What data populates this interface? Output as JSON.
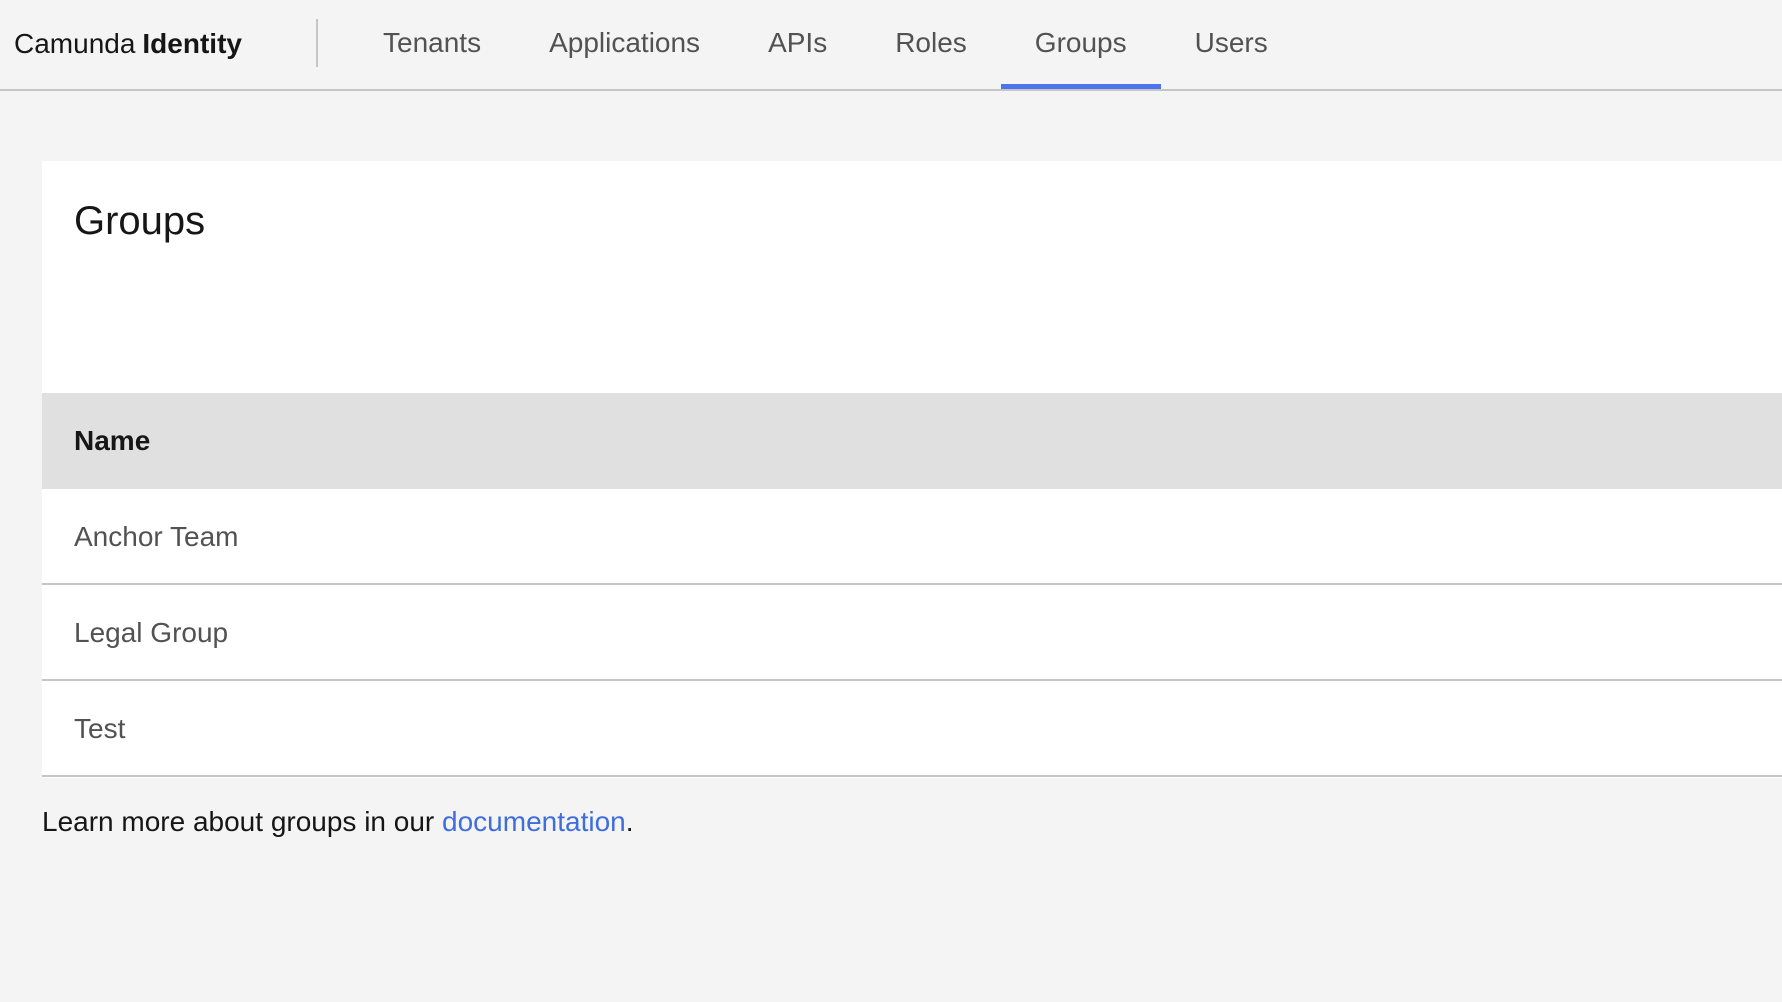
{
  "header": {
    "brand_prefix": "Camunda",
    "brand_strong": "Identity",
    "tabs": [
      {
        "label": "Tenants",
        "active": false
      },
      {
        "label": "Applications",
        "active": false
      },
      {
        "label": "APIs",
        "active": false
      },
      {
        "label": "Roles",
        "active": false
      },
      {
        "label": "Groups",
        "active": true
      },
      {
        "label": "Users",
        "active": false
      }
    ]
  },
  "main": {
    "title": "Groups",
    "table": {
      "columns": [
        "Name"
      ],
      "rows": [
        {
          "name": "Anchor Team"
        },
        {
          "name": "Legal Group"
        },
        {
          "name": "Test"
        }
      ]
    },
    "footer": {
      "text_before": "Learn more about groups in our ",
      "link_text": "documentation",
      "text_after": "."
    }
  },
  "colors": {
    "accent": "#4d74ec",
    "link": "#3f6ddd",
    "background": "#f4f4f4",
    "table_header": "#e0e0e0"
  }
}
